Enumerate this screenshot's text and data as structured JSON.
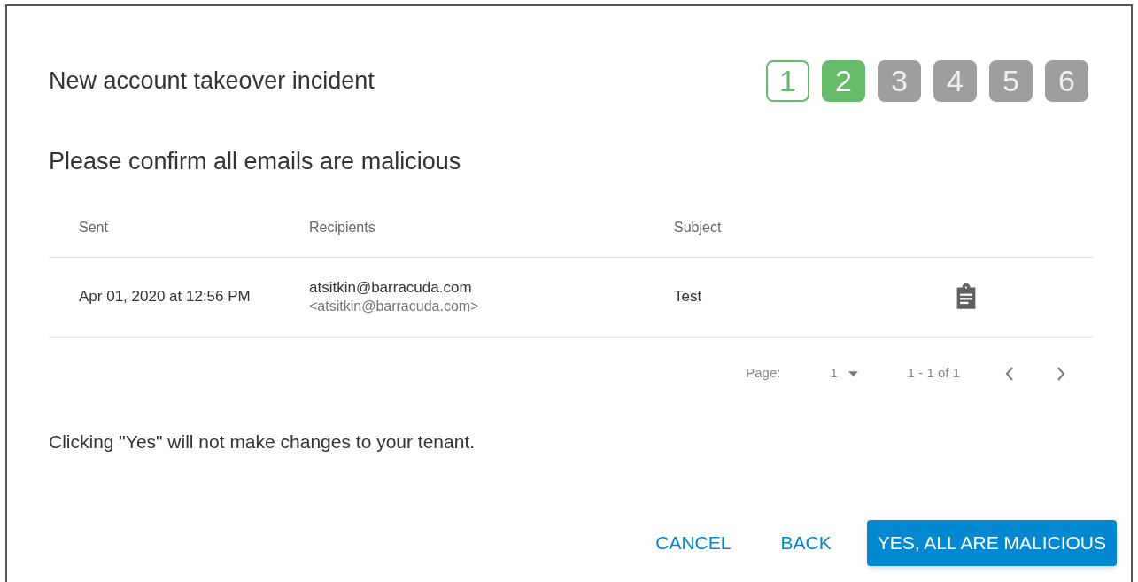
{
  "dialog": {
    "title": "New account takeover incident",
    "steps": [
      {
        "label": "1",
        "completed": true,
        "selected": false
      },
      {
        "label": "2",
        "completed": false,
        "selected": true
      },
      {
        "label": "3",
        "completed": false,
        "selected": false
      },
      {
        "label": "4",
        "completed": false,
        "selected": false
      },
      {
        "label": "5",
        "completed": false,
        "selected": false
      },
      {
        "label": "6",
        "completed": false,
        "selected": false
      }
    ],
    "heading": "Please confirm all emails are malicious",
    "table": {
      "columns": [
        "Sent",
        "Recipients",
        "Subject"
      ],
      "rows": [
        {
          "sent": "Apr 01, 2020 at 12:56 PM",
          "recipient_name": "atsitkin@barracuda.com",
          "recipient_address": "<atsitkin@barracuda.com>",
          "subject": "Test"
        }
      ]
    },
    "pagination": {
      "page_label": "Page:",
      "page": "1",
      "range": "1 - 1 of 1"
    },
    "note": "Clicking \"Yes\" will not make changes to your tenant.",
    "buttons": [
      {
        "label": "CANCEL",
        "kind": "text"
      },
      {
        "label": "BACK",
        "kind": "text"
      },
      {
        "label": "YES, ALL ARE MALICIOUS",
        "kind": "primary"
      }
    ]
  }
}
